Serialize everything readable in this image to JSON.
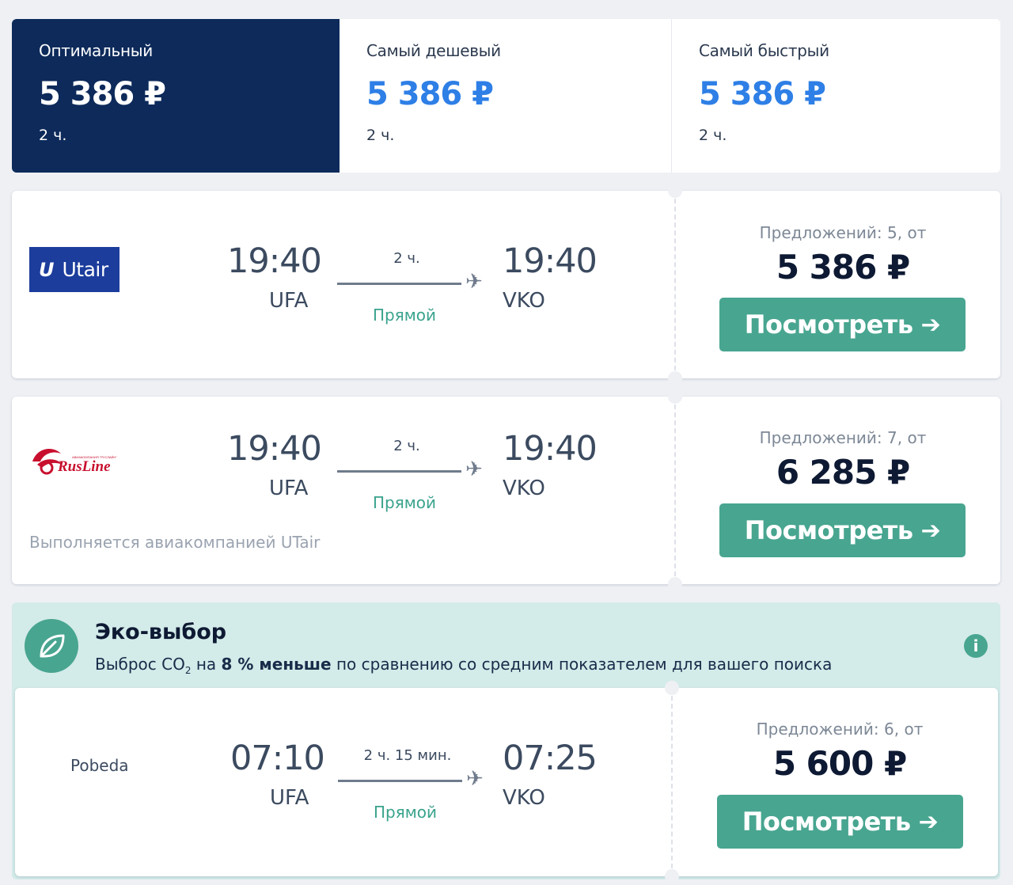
{
  "tabs": [
    {
      "label": "Оптимальный",
      "price": "5 386 ₽",
      "duration": "2 ч."
    },
    {
      "label": "Самый дешевый",
      "price": "5 386 ₽",
      "duration": "2 ч."
    },
    {
      "label": "Самый быстрый",
      "price": "5 386 ₽",
      "duration": "2 ч."
    }
  ],
  "flights": [
    {
      "airline": "Utair",
      "airline_mark": "U",
      "depart_time": "19:40",
      "depart_code": "UFA",
      "duration": "2 ч.",
      "stops": "Прямой",
      "arrive_time": "19:40",
      "arrive_code": "VKO",
      "offers": "Предложений: 5, от",
      "price": "5 386 ₽",
      "button": "Посмотреть"
    },
    {
      "airline": "RusLine",
      "operator": "Выполняется авиакомпанией UTair",
      "depart_time": "19:40",
      "depart_code": "UFA",
      "duration": "2 ч.",
      "stops": "Прямой",
      "arrive_time": "19:40",
      "arrive_code": "VKO",
      "offers": "Предложений: 7, от",
      "price": "6 285 ₽",
      "button": "Посмотреть"
    },
    {
      "airline": "Pobeda",
      "depart_time": "07:10",
      "depart_code": "UFA",
      "duration": "2 ч. 15 мин.",
      "stops": "Прямой",
      "arrive_time": "07:25",
      "arrive_code": "VKO",
      "offers": "Предложений: 6, от",
      "price": "5 600 ₽",
      "button": "Посмотреть"
    }
  ],
  "eco": {
    "title": "Эко-выбор",
    "desc_prefix": "Выброс CO",
    "desc_sub": "2",
    "desc_mid": " на ",
    "desc_bold": "8 % меньше",
    "desc_suffix": " по сравнению со средним показателем для вашего поиска",
    "info_icon": "info-icon",
    "leaf_icon": "leaf-icon"
  },
  "colors": {
    "selected_tab": "#0d2a5a",
    "price_blue": "#2e7fe6",
    "accent_green": "#48a590",
    "eco_bg": "#d3ebe9"
  }
}
